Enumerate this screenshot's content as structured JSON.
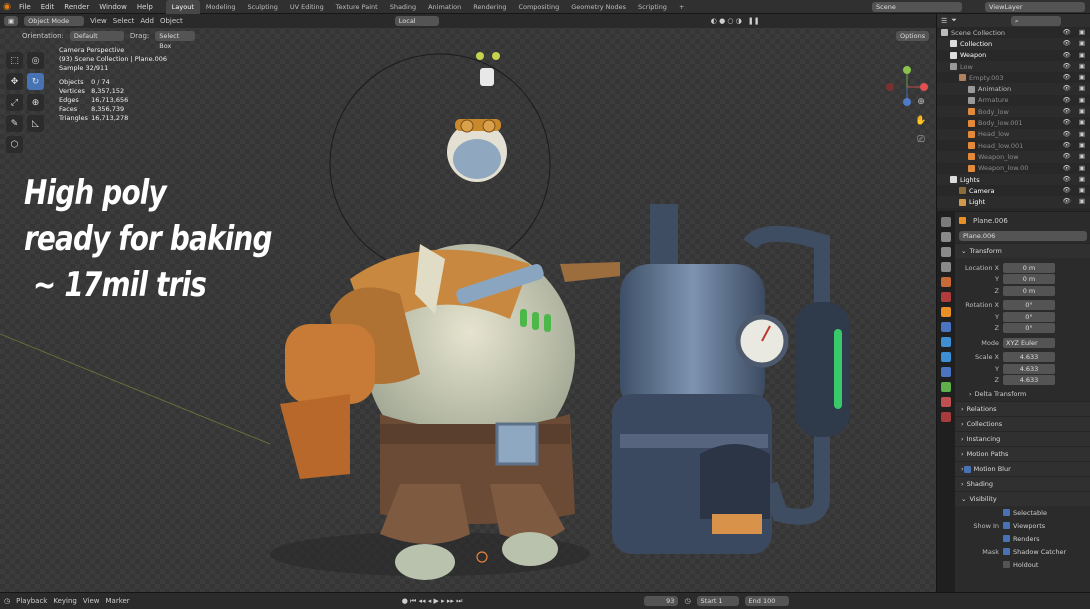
{
  "menu": [
    "File",
    "Edit",
    "Render",
    "Window",
    "Help"
  ],
  "workspaces": [
    "Layout",
    "Modeling",
    "Sculpting",
    "UV Editing",
    "Texture Paint",
    "Shading",
    "Animation",
    "Rendering",
    "Compositing",
    "Geometry Nodes",
    "Scripting"
  ],
  "scene_name": "Scene",
  "view_layer": "ViewLayer",
  "viewport_header": {
    "mode": "Object Mode",
    "items": [
      "View",
      "Select",
      "Add",
      "Object"
    ],
    "transform": "Local",
    "options": "Options"
  },
  "viewport_header2": {
    "orientation_label": "Orientation:",
    "orientation": "Default",
    "drag_label": "Drag:",
    "drag": "Select Box"
  },
  "stats": {
    "line1": "Camera Perspective",
    "line2": "(93) Scene Collection | Plane.006",
    "line3": "Sample 32/911",
    "rows": [
      {
        "k": "Objects",
        "v": "0 / 74"
      },
      {
        "k": "Vertices",
        "v": "8,357,152"
      },
      {
        "k": "Edges",
        "v": "16,713,656"
      },
      {
        "k": "Faces",
        "v": "8,356,739"
      },
      {
        "k": "Triangles",
        "v": "16,713,278"
      }
    ]
  },
  "overlay_text": [
    "High poly",
    "ready for baking",
    " ~ 17mil tris"
  ],
  "outliner": {
    "rows": [
      {
        "label": "Scene Collection",
        "indent": 0,
        "color": "#bfbfbf"
      },
      {
        "label": "Collection",
        "indent": 1,
        "color": "#ffffff"
      },
      {
        "label": "Weapon",
        "indent": 1,
        "color": "#ffffff"
      },
      {
        "label": "Low",
        "indent": 1,
        "color": "#8a8a8a"
      },
      {
        "label": "Empty.003",
        "indent": 2,
        "color": "#8a8a8a"
      },
      {
        "label": "Animation",
        "indent": 3,
        "color": "#bfbfbf"
      },
      {
        "label": "Armature",
        "indent": 3,
        "color": "#8a8a8a"
      },
      {
        "label": "Body_low",
        "indent": 3,
        "color": "#8a8a8a"
      },
      {
        "label": "Body_low.001",
        "indent": 3,
        "color": "#8a8a8a"
      },
      {
        "label": "Head_low",
        "indent": 3,
        "color": "#8a8a8a"
      },
      {
        "label": "Head_low.001",
        "indent": 3,
        "color": "#8a8a8a"
      },
      {
        "label": "Weapon_low",
        "indent": 3,
        "color": "#8a8a8a"
      },
      {
        "label": "Weapon_low.00",
        "indent": 3,
        "color": "#8a8a8a"
      },
      {
        "label": "Lights",
        "indent": 1,
        "color": "#ffffff"
      },
      {
        "label": "Camera",
        "indent": 2,
        "color": "#ffffff"
      },
      {
        "label": "Light",
        "indent": 2,
        "color": "#ffffff"
      }
    ]
  },
  "properties": {
    "object_name": "Plane.006",
    "data_name": "Plane.006",
    "transform_title": "Transform",
    "location": {
      "label": "Location X",
      "x": "0 m",
      "y": "0 m",
      "z": "0 m"
    },
    "rotation": {
      "label": "Rotation X",
      "x": "0°",
      "y": "0°",
      "z": "0°"
    },
    "mode_label": "Mode",
    "mode": "XYZ Euler",
    "scale": {
      "label": "Scale X",
      "x": "4.633",
      "y": "4.633",
      "z": "4.633"
    },
    "y_label": "Y",
    "z_label": "Z",
    "delta": "Delta Transform",
    "sections": [
      "Relations",
      "Collections",
      "Instancing",
      "Motion Paths",
      "Motion Blur",
      "Shading",
      "Visibility"
    ],
    "visibility": {
      "selectable": "Selectable",
      "show_in": "Show In",
      "viewports": "Viewports",
      "renders": "Renders",
      "mask": "Mask",
      "shadow_catcher": "Shadow Catcher",
      "holdout": "Holdout"
    }
  },
  "timeline": {
    "items": [
      "Playback",
      "Keying",
      "View",
      "Marker"
    ],
    "frame": "93",
    "start_label": "Start",
    "start": "1",
    "end_label": "End",
    "end": "100"
  }
}
